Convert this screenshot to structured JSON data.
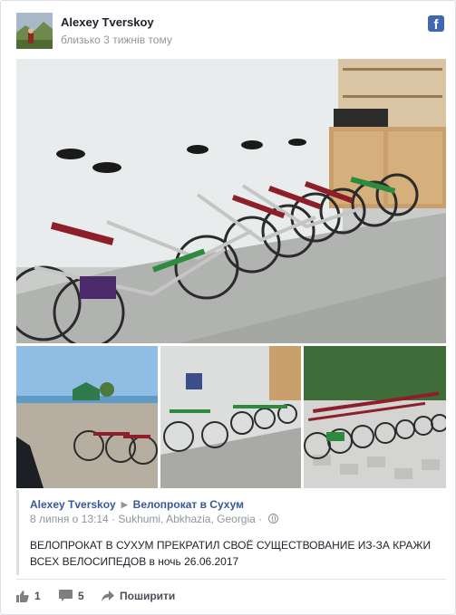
{
  "post": {
    "author": "Alexey Tverskoy",
    "time": "близько 3 тижнів тому",
    "network_icon": "facebook-icon"
  },
  "shared": {
    "author": "Alexey Tverskoy",
    "page": "Велопрокат в Сухум",
    "date": "8 липня о 13:14",
    "location": "Sukhumi, Abkhazia, Georgia",
    "separator": "·",
    "text": "ВЕЛОПРОКАТ В СУХУМ ПРЕКРАТИЛ СВОЁ СУЩЕСТВОВАНИЕ ИЗ-ЗА КРАЖИ ВСЕХ ВЕЛОСИПЕДОВ в ночь 26.06.2017"
  },
  "actions": {
    "likes": "1",
    "comments": "5",
    "share_label": "Поширити"
  },
  "colors": {
    "link": "#365899",
    "brand": "#4267b2",
    "muted": "#90949c"
  }
}
